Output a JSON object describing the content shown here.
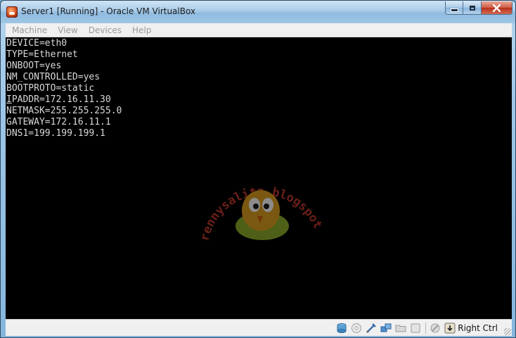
{
  "window": {
    "title": "Server1 [Running] - Oracle VM VirtualBox",
    "controls": {
      "minimize": "minimize-icon",
      "maximize": "maximize-icon",
      "close": "close-icon"
    }
  },
  "menu": {
    "items": [
      {
        "label": "Machine"
      },
      {
        "label": "View"
      },
      {
        "label": "Devices"
      },
      {
        "label": "Help"
      }
    ]
  },
  "console": {
    "first_char": "I",
    "lines": [
      "DEVICE=eth0",
      "TYPE=Ethernet",
      "ONBOOT=yes",
      "NM_CONTROLLED=yes",
      "BOOTPROTO=static",
      "IPADDR=172.16.11.30",
      "NETMASK=255.255.255.0",
      "GATEWAY=172.16.11.1",
      "DNS1=199.199.199.1"
    ],
    "ipaddr_rest": "PADDR=172.16.11.30"
  },
  "watermark": {
    "text": "rennysalita.blogspot.com"
  },
  "statusbar": {
    "icons": [
      "hard-disk-icon",
      "optical-drive-icon",
      "usb-icon",
      "network-icon",
      "shared-folders-icon",
      "display-icon",
      "mouse-integration-icon",
      "host-key-icon"
    ],
    "host_key_label": "Right Ctrl"
  },
  "colors": {
    "console_bg": "#000000",
    "console_text": "#d8d8d8",
    "menu_disabled": "#9a9a9a"
  }
}
